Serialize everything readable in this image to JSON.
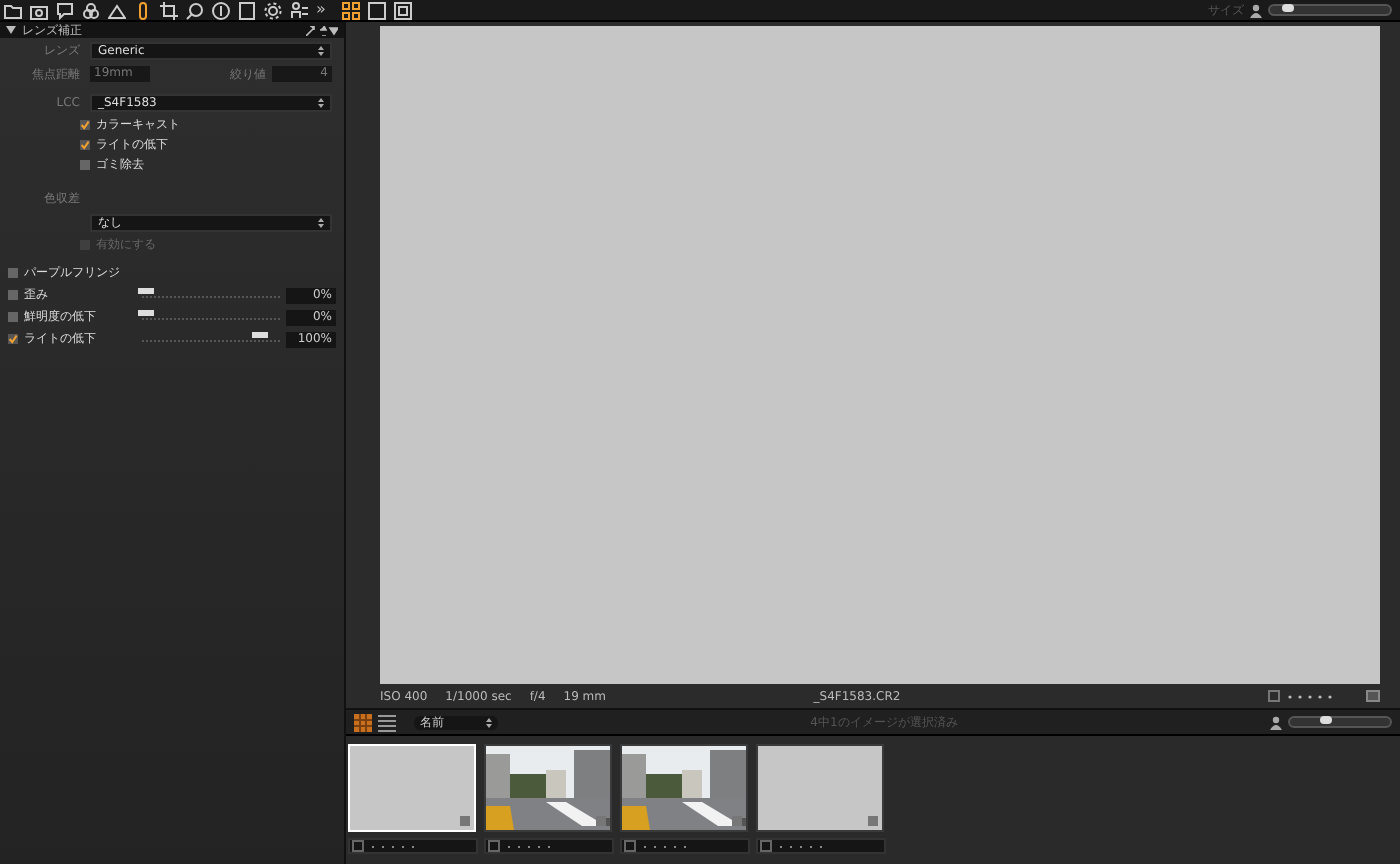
{
  "toolbar": {
    "tools": [
      {
        "selected": false
      },
      {
        "selected": false
      },
      {
        "selected": false
      },
      {
        "selected": false
      },
      {
        "selected": false
      },
      {
        "selected": true
      },
      {
        "selected": false
      },
      {
        "selected": false
      },
      {
        "selected": false
      },
      {
        "selected": false
      },
      {
        "selected": false
      },
      {
        "selected": false
      }
    ],
    "more": "»",
    "views": [
      {
        "selected": true
      },
      {
        "selected": false
      },
      {
        "selected": false
      }
    ],
    "size_label": "サイズ",
    "size_slider": {
      "level": 0.1
    }
  },
  "panel": {
    "title": "レンズ補正",
    "lens": {
      "label": "レンズ",
      "value": "Generic"
    },
    "focal": {
      "label": "焦点距離",
      "value": "19mm"
    },
    "aperture": {
      "label": "絞り値",
      "value": "4"
    },
    "lcc": {
      "label": "LCC",
      "value": "_S4F1583",
      "options": [
        {
          "label": "カラーキャスト",
          "checked": true
        },
        {
          "label": "ライトの低下",
          "checked": true
        },
        {
          "label": "ゴミ除去",
          "checked": false
        }
      ]
    },
    "chromatic": {
      "label": "色収差",
      "value": "なし",
      "option": {
        "label": "有効にする",
        "checked": false,
        "disabled": true
      }
    },
    "fringe": {
      "label": "パープルフリンジ",
      "checked": false
    },
    "sliders": [
      {
        "label": "歪み",
        "checked": false,
        "level": 0,
        "reading": "0%"
      },
      {
        "label": "鮮明度の低下",
        "checked": false,
        "level": 0,
        "reading": "0%"
      },
      {
        "label": "ライトの低下",
        "checked": true,
        "level": 0.83,
        "reading": "100%"
      }
    ]
  },
  "viewer": {
    "iso": "ISO 400",
    "shutter": "1/1000 sec",
    "aperture": "f/4",
    "focal": "19 mm",
    "filename": "_S4F1583.CR2"
  },
  "browser": {
    "sort": "名前",
    "status": "4中1のイメージが選択済み",
    "zoom_slider": {
      "level": 0.3
    },
    "thumbnails": [
      {
        "kind": "blank",
        "selected": true
      },
      {
        "kind": "picture",
        "selected": false
      },
      {
        "kind": "picture",
        "selected": false
      },
      {
        "kind": "blank",
        "selected": false
      }
    ]
  }
}
